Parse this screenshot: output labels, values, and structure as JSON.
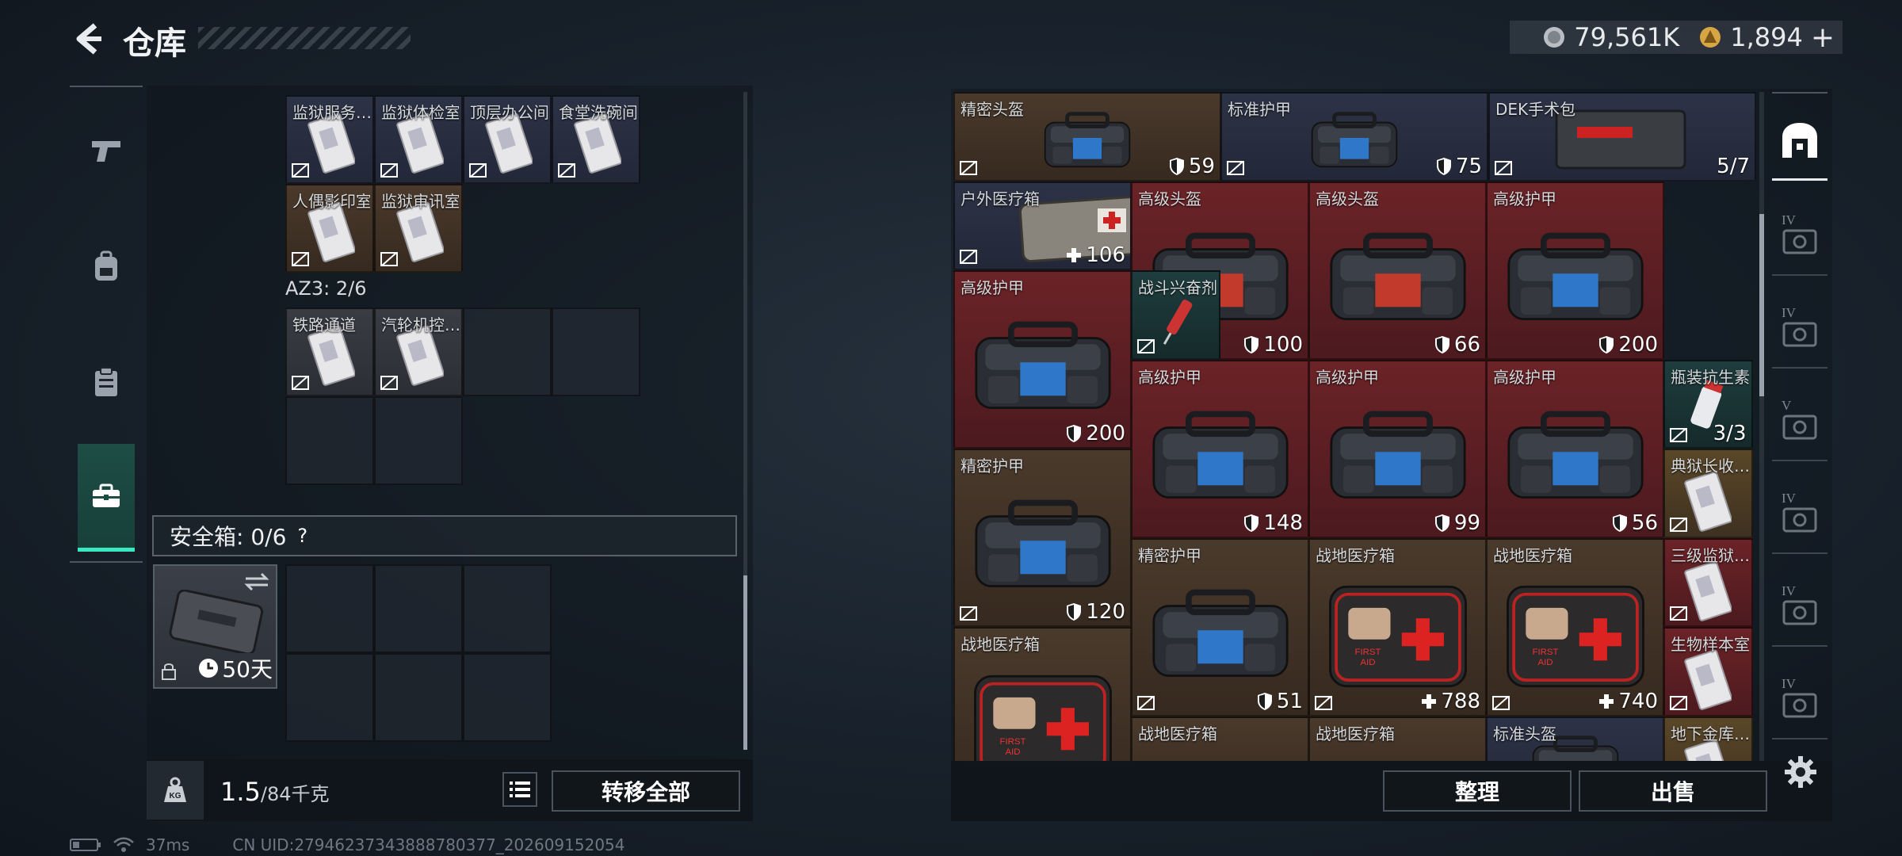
{
  "header": {
    "title": "仓库"
  },
  "currency": {
    "silver": "79,561K",
    "gold": "1,894",
    "gold_plus": "+"
  },
  "left_grid": {
    "row1": [
      {
        "name": "监狱服务…"
      },
      {
        "name": "监狱体检室"
      },
      {
        "name": "顶层办公间"
      },
      {
        "name": "食堂洗碗间"
      }
    ],
    "row2": [
      {
        "name": "人偶影印室"
      },
      {
        "name": "监狱审讯室"
      }
    ],
    "az3_label": "AZ3: 2/6",
    "row3": [
      {
        "name": "铁路通道"
      },
      {
        "name": "汽轮机控…"
      }
    ]
  },
  "safebox": {
    "label": "安全箱: 0/6",
    "help": "?",
    "days": "50天"
  },
  "bottom_left": {
    "weight": "1.5",
    "weight_max": "/84千克",
    "transfer_all": "转移全部"
  },
  "bottom_right": {
    "sort": "整理",
    "sell": "出售"
  },
  "status": {
    "ping": "37ms",
    "uid": "CN UID:27946237343888780377_202609152054"
  },
  "stash": [
    {
      "name": "精密头盔",
      "value": "59",
      "type": "shield"
    },
    {
      "name": "标准护甲",
      "value": "75",
      "type": "shield"
    },
    {
      "name": "DEK手术包",
      "value": "5/7",
      "type": "none"
    },
    {
      "name": "户外医疗箱",
      "value": "106",
      "type": "plus"
    },
    {
      "name": "高级头盔",
      "value": "100",
      "type": "shield"
    },
    {
      "name": "高级头盔",
      "value": "66",
      "type": "shield"
    },
    {
      "name": "高级护甲",
      "value": "200",
      "type": "shield"
    },
    {
      "name": "高级护甲",
      "value": "200",
      "type": "shield"
    },
    {
      "name": "战斗兴奋剂",
      "value": "",
      "type": "none"
    },
    {
      "name": "高级护甲",
      "value": "148",
      "type": "shield"
    },
    {
      "name": "高级护甲",
      "value": "99",
      "type": "shield"
    },
    {
      "name": "高级护甲",
      "value": "56",
      "type": "shield"
    },
    {
      "name": "瓶装抗生素",
      "value": "3/3",
      "type": "none"
    },
    {
      "name": "精密护甲",
      "value": "120",
      "type": "shield"
    },
    {
      "name": "典狱长收…",
      "value": "",
      "type": "none"
    },
    {
      "name": "精密护甲",
      "value": "51",
      "type": "shield"
    },
    {
      "name": "战地医疗箱",
      "value": "788",
      "type": "plus"
    },
    {
      "name": "战地医疗箱",
      "value": "740",
      "type": "plus"
    },
    {
      "name": "三级监狱…",
      "value": "",
      "type": "none"
    },
    {
      "name": "战地医疗箱",
      "value": "",
      "type": "none"
    },
    {
      "name": "生物样本室",
      "value": "",
      "type": "none"
    },
    {
      "name": "战地医疗箱",
      "value": "",
      "type": "none"
    },
    {
      "name": "战地医疗箱",
      "value": "",
      "type": "none"
    },
    {
      "name": "标准头盔",
      "value": "",
      "type": "none"
    },
    {
      "name": "地下金库…",
      "value": "",
      "type": "none"
    }
  ],
  "right_tabs": [
    "IV",
    "IV",
    "V",
    "IV",
    "IV",
    "IV"
  ]
}
